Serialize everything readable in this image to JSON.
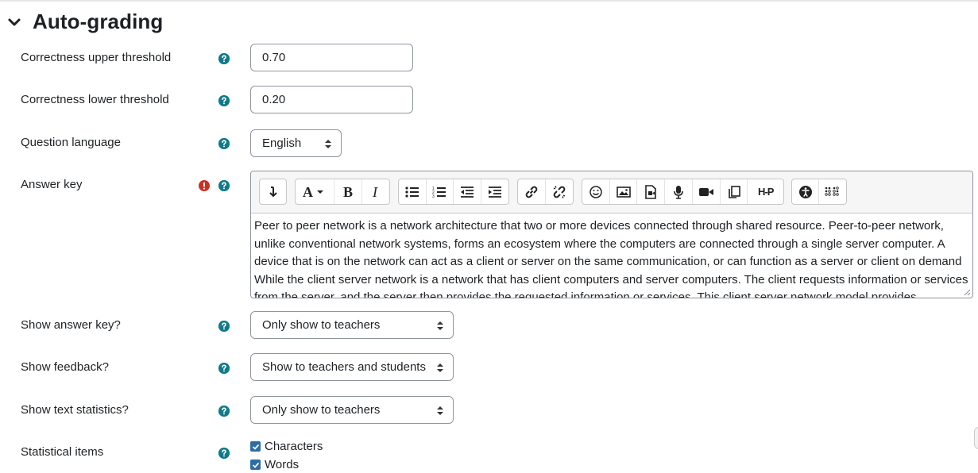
{
  "section": {
    "title": "Auto-grading"
  },
  "fields": {
    "upper_threshold": {
      "label": "Correctness upper threshold",
      "value": "0.70"
    },
    "lower_threshold": {
      "label": "Correctness lower threshold",
      "value": "0.20"
    },
    "question_language": {
      "label": "Question language",
      "value": "English"
    },
    "answer_key": {
      "label": "Answer key",
      "text": "Peer to peer network is a network architecture that two or more devices connected through shared resource. Peer-to-peer network, unlike conventional network systems, forms an ecosystem where the computers are connected through a single server computer. A device that is on the network can act as a client or server on the same communication, or can function as a server or client on demand While the client server network is a network that has client computers and server computers. The client requests information or services from the server, and the server then provides the requested information or services. This client server network model provides"
    },
    "show_answer_key": {
      "label": "Show answer key?",
      "value": "Only show to teachers"
    },
    "show_feedback": {
      "label": "Show feedback?",
      "value": "Show to teachers and students"
    },
    "show_text_statistics": {
      "label": "Show text statistics?",
      "value": "Only show to teachers"
    },
    "statistical_items": {
      "label": "Statistical items",
      "options": [
        {
          "label": "Characters",
          "checked": true
        },
        {
          "label": "Words",
          "checked": true
        }
      ]
    }
  },
  "toolbar": {
    "groups": [
      [
        "collapse-icon"
      ],
      [
        "font-icon",
        "bold-icon",
        "italic-icon"
      ],
      [
        "unordered-list-icon",
        "ordered-list-icon",
        "outdent-icon",
        "indent-icon"
      ],
      [
        "link-icon",
        "unlink-icon"
      ],
      [
        "emoji-icon",
        "image-icon",
        "media-icon",
        "record-audio-icon",
        "record-video-icon",
        "manage-files-icon",
        "h5p-icon"
      ],
      [
        "accessibility-checker-icon",
        "screenreader-helper-icon"
      ]
    ],
    "h5p_text": "H-P"
  },
  "colors": {
    "help": "#0f7a8a",
    "error": "#ca3120",
    "checkbox": "#2e6da4"
  }
}
